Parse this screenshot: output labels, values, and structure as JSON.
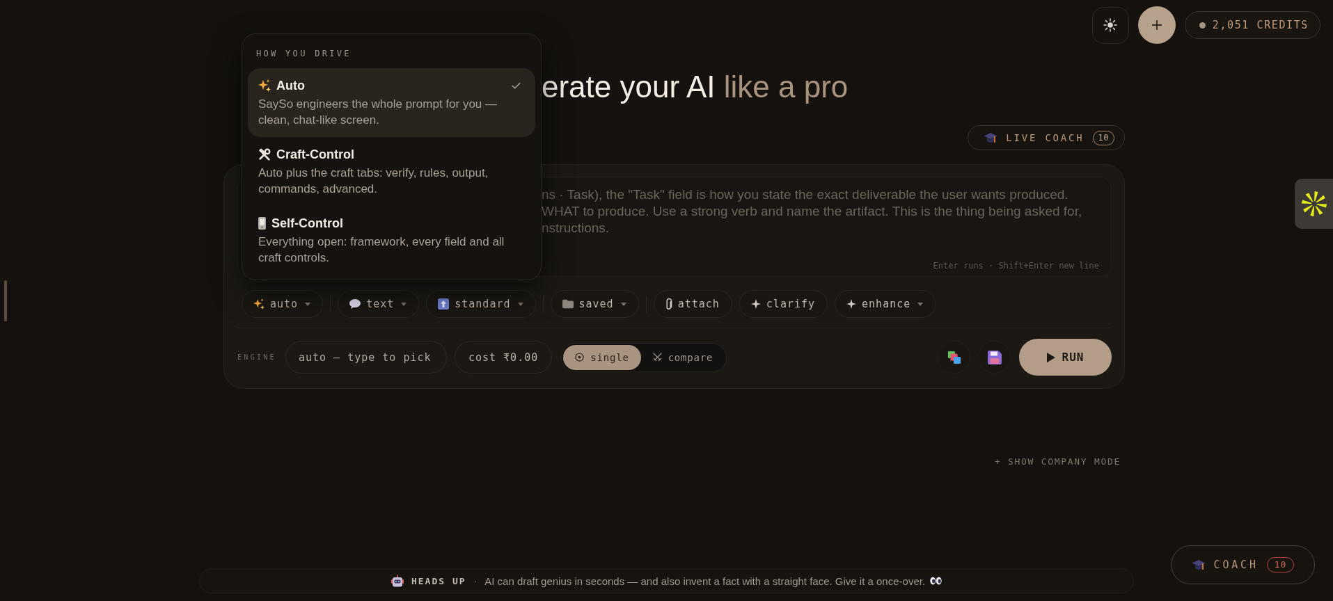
{
  "header": {
    "credits": "2,051 CREDITS"
  },
  "mode_menu": {
    "heading": "HOW YOU DRIVE",
    "items": [
      {
        "title": "Auto",
        "description": "SaySo engineers the whole prompt for you — clean, chat-like screen.",
        "selected": true
      },
      {
        "title": "Craft-Control",
        "description": "Auto plus the craft tabs: verify, rules, output, commands, advanced.",
        "selected": false
      },
      {
        "title": "Self-Control",
        "description": "Everything open: framework, every field and all craft controls.",
        "selected": false
      }
    ]
  },
  "heading": {
    "text": "erate your AI",
    "accent": "like a pro"
  },
  "live_coach": {
    "label": "LIVE COACH",
    "count": "10"
  },
  "composer": {
    "placeholder": "ns · Task), the \"Task\" field is how you state the exact deliverable the user wants produced.\nWHAT to produce. Use a strong verb and name the artifact. This is the thing being asked for,\nnstructions.",
    "hint": "Enter runs · Shift+Enter new line"
  },
  "toolbar": {
    "groups": [
      [
        {
          "label": "auto",
          "kind": "menu"
        }
      ],
      [
        {
          "label": "text",
          "kind": "menu"
        },
        {
          "label": "standard",
          "kind": "menu"
        }
      ],
      [
        {
          "label": "saved",
          "kind": "menu"
        }
      ],
      [
        {
          "label": "attach",
          "kind": "action"
        },
        {
          "label": "clarify",
          "kind": "action"
        },
        {
          "label": "enhance",
          "kind": "menu"
        }
      ]
    ]
  },
  "engine": {
    "label": "ENGINE",
    "placeholder": "auto — type to pick",
    "cost": "cost ₹0.00",
    "modes": [
      {
        "label": "single",
        "selected": true
      },
      {
        "label": "compare",
        "selected": false
      }
    ],
    "run": "RUN"
  },
  "company_mode": "+ SHOW COMPANY MODE",
  "notice": {
    "title": "HEADS UP",
    "separator": "·",
    "text": "AI can draft genius in seconds — and also invent a fact with a straight face. Give it a once-over."
  },
  "coach_button": {
    "label": "COACH",
    "count": "10"
  }
}
